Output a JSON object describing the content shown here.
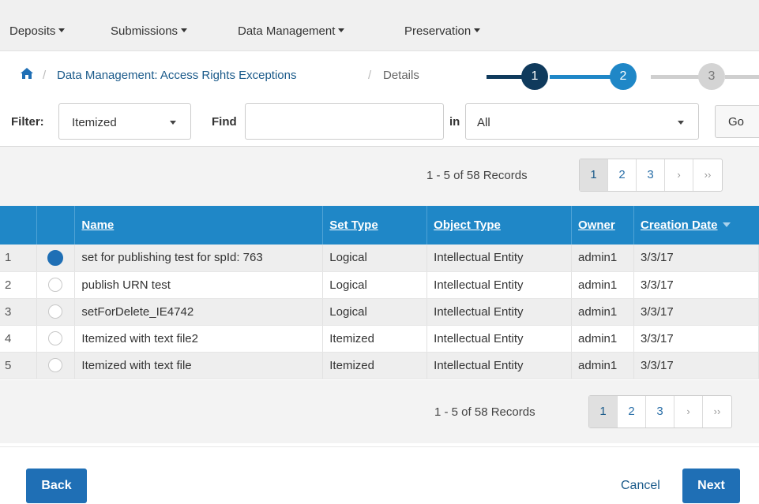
{
  "menu": [
    {
      "label": "Deposits"
    },
    {
      "label": "Submissions"
    },
    {
      "label": "Data Management"
    },
    {
      "label": "Preservation"
    }
  ],
  "breadcrumb": {
    "section": "Data Management: Access Rights Exceptions",
    "current": "Details",
    "separator": "/"
  },
  "stepper": {
    "steps": [
      "1",
      "2",
      "3"
    ],
    "active": 2,
    "colors": {
      "done": "#0f3a5c",
      "active": "#1f87c7",
      "pending": "#d4d4d4"
    }
  },
  "filter": {
    "filter_label": "Filter:",
    "filter_value": "Itemized",
    "find_label": "Find",
    "find_value": "",
    "in_label": "in",
    "in_value": "All",
    "go_label": "Go"
  },
  "pagination": {
    "records_text": "1 - 5 of 58 Records",
    "pages": [
      "1",
      "2",
      "3"
    ],
    "current_page": "1",
    "next_label": "›",
    "last_label": "››"
  },
  "table": {
    "columns": [
      "Name",
      "Set Type",
      "Object Type",
      "Owner",
      "Creation Date"
    ],
    "rows": [
      {
        "num": "1",
        "selected": true,
        "name": "set for publishing test for spId: 763",
        "set_type": "Logical",
        "object_type": "Intellectual Entity",
        "owner": "admin1",
        "date": "3/3/17"
      },
      {
        "num": "2",
        "selected": false,
        "name": "publish URN test",
        "set_type": "Logical",
        "object_type": "Intellectual Entity",
        "owner": "admin1",
        "date": "3/3/17"
      },
      {
        "num": "3",
        "selected": false,
        "name": "setForDelete_IE4742",
        "set_type": "Logical",
        "object_type": "Intellectual Entity",
        "owner": "admin1",
        "date": "3/3/17"
      },
      {
        "num": "4",
        "selected": false,
        "name": "Itemized with text file2",
        "set_type": "Itemized",
        "object_type": "Intellectual Entity",
        "owner": "admin1",
        "date": "3/3/17"
      },
      {
        "num": "5",
        "selected": false,
        "name": "Itemized with text file",
        "set_type": "Itemized",
        "object_type": "Intellectual Entity",
        "owner": "admin1",
        "date": "3/3/17"
      }
    ]
  },
  "footer": {
    "back_label": "Back",
    "cancel_label": "Cancel",
    "next_label": "Next"
  },
  "colors": {
    "accent": "#1f87c7",
    "button": "#1f6fb5",
    "link": "#1a5a8a"
  }
}
